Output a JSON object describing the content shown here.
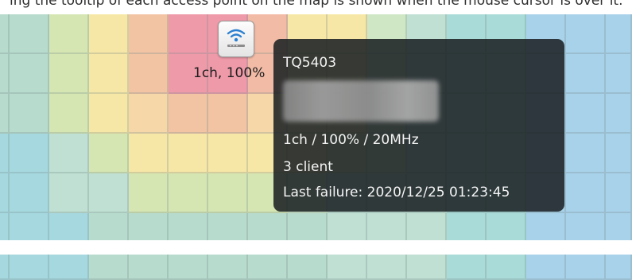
{
  "caption": "ing the tooltip of each access point on the map is shown when the mouse cursor is over it.",
  "heatmap": {
    "rows": [
      [
        "#b7dccd",
        "#b7dccd",
        "#d5e6b2",
        "#f7e7a6",
        "#f2c4a4",
        "#ef9aa9",
        "#ef9aa9",
        "#f2bba6",
        "#f7e7a6",
        "#f7e7a6",
        "#cfe7c5",
        "#bfe0d3",
        "#a9dbd9",
        "#a9dbd9",
        "#a8d2ea",
        "#a8d2ea",
        "#a8d2ea"
      ],
      [
        "#b7dccd",
        "#b7dccd",
        "#d5e6b2",
        "#f7e7a6",
        "#f2c4a4",
        "#ef9aa9",
        "#ef9aa9",
        "#f2bba6",
        "#f7e7a6",
        "#f7e7a6",
        "#cfe7c5",
        "#bfe0d3",
        "#a9dbd9",
        "#a9dbd9",
        "#a8d2ea",
        "#a8d2ea",
        "#a8d2ea"
      ],
      [
        "#b7dccd",
        "#b7dccd",
        "#d5e6b2",
        "#f7e7a6",
        "#f6d8a8",
        "#f2c4a4",
        "#f2c4a4",
        "#f6d8a8",
        "#f7e7a6",
        "#f7e7a6",
        "#cfe7c5",
        "#bfe0d3",
        "#a9dbd9",
        "#a9dbd9",
        "#a8d2ea",
        "#a8d2ea",
        "#a8d2ea"
      ],
      [
        "#a6d8e0",
        "#a6d8e0",
        "#bfe0d3",
        "#d5e6b2",
        "#f7e7a6",
        "#f7e7a6",
        "#f7e7a6",
        "#f7e7a6",
        "#f7e7a6",
        "#d5e6b2",
        "#cfe7c5",
        "#bfe0d3",
        "#a9dbd9",
        "#a9dbd9",
        "#a8d2ea",
        "#a8d2ea",
        "#a8d2ea"
      ],
      [
        "#a6d8e0",
        "#a6d8e0",
        "#bfe0d3",
        "#bfe0d3",
        "#d5e6b2",
        "#d5e6b2",
        "#d5e6b2",
        "#d5e6b2",
        "#cfe7c5",
        "#bfe0d3",
        "#bfe0d3",
        "#bfe0d3",
        "#a9dbd9",
        "#a9dbd9",
        "#a8d2ea",
        "#a8d2ea",
        "#a8d2ea"
      ],
      [
        "#a6d8e0",
        "#a6d8e0",
        "#a6d8e0",
        "#b7dccd",
        "#b7dccd",
        "#b7dccd",
        "#b7dccd",
        "#b7dccd",
        "#b7dccd",
        "#bfe0d3",
        "#bfe0d3",
        "#bfe0d3",
        "#a9dbd9",
        "#a9dbd9",
        "#a8d2ea",
        "#a8d2ea",
        "#a8d2ea"
      ],
      [
        "#a6d8e0",
        "#a6d8e0",
        "#a6d8e0",
        "#b7dccd",
        "#b7dccd",
        "#b7dccd",
        "#b7dccd",
        "#b7dccd",
        "#b7dccd",
        "#bfe0d3",
        "#bfe0d3",
        "#bfe0d3",
        "#a9dbd9",
        "#a9dbd9",
        "#a8d2ea",
        "#a8d2ea",
        "#a8d2ea"
      ]
    ]
  },
  "access_point": {
    "icon": "wifi-icon",
    "label": "1ch, 100%"
  },
  "tooltip": {
    "name": "TQ5403",
    "channel_info": "1ch / 100% / 20MHz",
    "clients": "3 client",
    "last_failure": "Last failure: 2020/12/25 01:23:45"
  }
}
